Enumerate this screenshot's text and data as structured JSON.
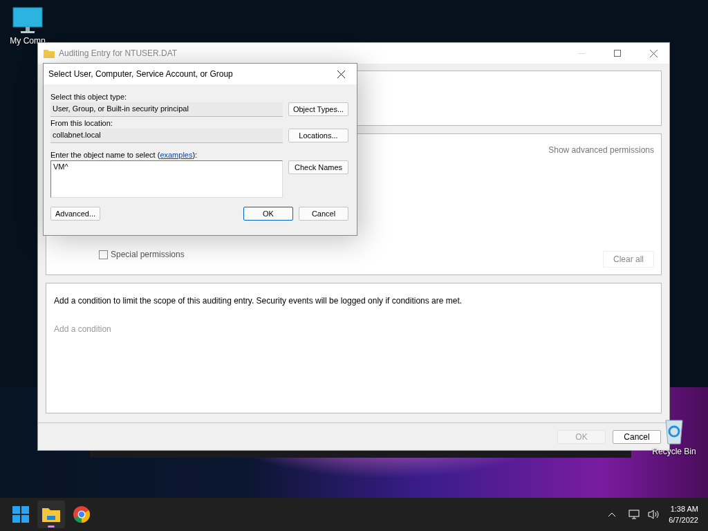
{
  "desktop_icons": [
    {
      "kind": "computer",
      "label": "My Comp"
    },
    {
      "kind": "recycle",
      "label": "Recycle Bin"
    }
  ],
  "auditing_window": {
    "title": "Auditing Entry for NTUSER.DAT",
    "show_advanced": "Show advanced permissions",
    "special_permissions": {
      "label": "Special permissions",
      "checked": false
    },
    "clear_all": "Clear all",
    "condition_text": "Add a condition to limit the scope of this auditing entry. Security events will be logged only if conditions are met.",
    "add_condition": "Add a condition",
    "buttons": [
      {
        "label": "OK",
        "disabled": true
      },
      {
        "label": "Cancel",
        "disabled": false
      }
    ]
  },
  "select_dialog": {
    "title": "Select User, Computer, Service Account, or Group",
    "object_type_label": "Select this object type:",
    "object_type_value": "User, Group, or Built-in security principal",
    "object_types_button": "Object Types...",
    "location_label": "From this location:",
    "location_value": "collabnet.local",
    "locations_button": "Locations...",
    "name_label_before": "Enter the object name to select (",
    "examples_link": "examples",
    "name_label_after": "):",
    "name_value": "VM^",
    "check_names_button": "Check Names",
    "advanced_button": "Advanced...",
    "ok_button": "OK",
    "cancel_button": "Cancel"
  },
  "taskbar": {
    "apps": [
      {
        "kind": "explorer",
        "active": true
      },
      {
        "kind": "chrome",
        "active": false
      }
    ],
    "time": "1:38 AM",
    "date": "6/7/2022"
  }
}
